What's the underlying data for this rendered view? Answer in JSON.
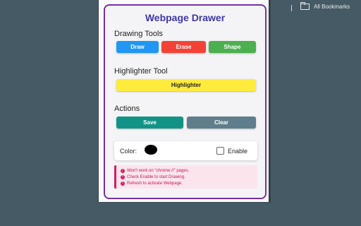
{
  "browser": {
    "bookmarks_label": "All Bookmarks"
  },
  "popup": {
    "title": "Webpage Drawer",
    "drawing_tools": {
      "heading": "Drawing Tools",
      "buttons": [
        {
          "label": "Draw",
          "color": "#2196f3"
        },
        {
          "label": "Erase",
          "color": "#f44336"
        },
        {
          "label": "Shape",
          "color": "#4caf50"
        }
      ]
    },
    "highlighter": {
      "heading": "Highlighter Tool",
      "button_label": "Highlighter",
      "color": "#ffeb3b"
    },
    "actions": {
      "heading": "Actions",
      "save_label": "Save",
      "clear_label": "Clear"
    },
    "settings": {
      "color_label": "Color:",
      "current_color": "#000000",
      "enable_label": "Enable",
      "enabled": false
    },
    "notices": [
      "Won't work on \"chrome://\" pages.",
      "Check Enable to start Drawing.",
      "Refresh to activate Webpage."
    ]
  }
}
